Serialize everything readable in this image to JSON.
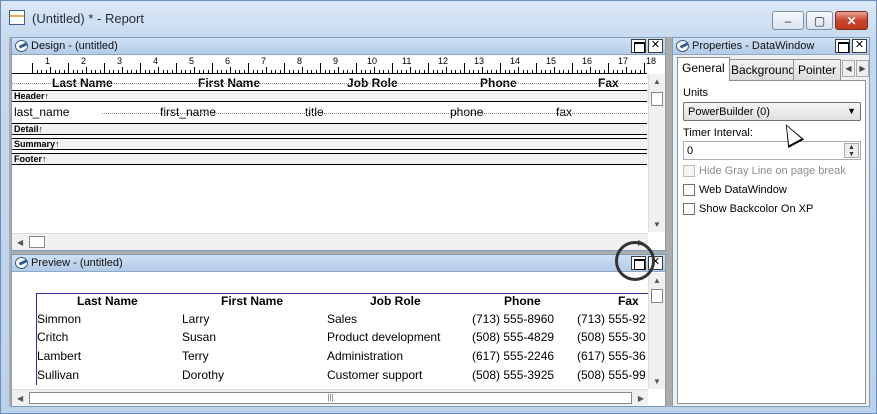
{
  "window": {
    "title": "(Untitled) * - Report"
  },
  "design": {
    "title": "Design - (untitled)",
    "ruler_numbers": [
      "1",
      "2",
      "3",
      "4",
      "5",
      "6",
      "7",
      "8",
      "9",
      "10",
      "11",
      "12",
      "13",
      "14",
      "15",
      "16",
      "17",
      "18"
    ],
    "header_columns": [
      "Last Name",
      "First Name",
      "Job Role",
      "Phone",
      "Fax"
    ],
    "bands": {
      "header": "Header↑",
      "detail": "Detail↑",
      "summary": "Summary↑",
      "footer": "Footer↑"
    },
    "detail_fields": [
      "last_name",
      "first_name",
      "title",
      "phone",
      "fax"
    ]
  },
  "preview": {
    "title": "Preview - (untitled)",
    "columns": [
      "Last Name",
      "First Name",
      "Job Role",
      "Phone",
      "Fax"
    ],
    "rows": [
      [
        "Simmon",
        "Larry",
        "Sales",
        "(713) 555-8960",
        "(713) 555-92"
      ],
      [
        "Critch",
        "Susan",
        "Product development",
        "(508) 555-4829",
        "(508) 555-30"
      ],
      [
        "Lambert",
        "Terry",
        "Administration",
        "(617) 555-2246",
        "(617) 555-36"
      ],
      [
        "Sullivan",
        "Dorothy",
        "Customer support",
        "(508) 555-3925",
        "(508) 555-99"
      ]
    ]
  },
  "properties": {
    "title": "Properties - DataWindow",
    "tabs": [
      "General",
      "Background",
      "Pointer"
    ],
    "active_tab": "General",
    "units_label": "Units",
    "units_value": "PowerBuilder (0)",
    "timer_label": "Timer Interval:",
    "timer_value": "0",
    "checkboxes": [
      {
        "label": "Hide Gray Line on page break",
        "checked": false,
        "enabled": false
      },
      {
        "label": "Web DataWindow",
        "checked": false,
        "enabled": true
      },
      {
        "label": "Show Backcolor On XP",
        "checked": false,
        "enabled": true
      }
    ]
  },
  "icons": {
    "close": "✕",
    "minimize": "–",
    "maximize": "▢",
    "scroll_up": "▲",
    "scroll_down": "▼",
    "scroll_left": "◀",
    "scroll_right": "▶",
    "dropdown": "▼",
    "grip": "|||"
  }
}
